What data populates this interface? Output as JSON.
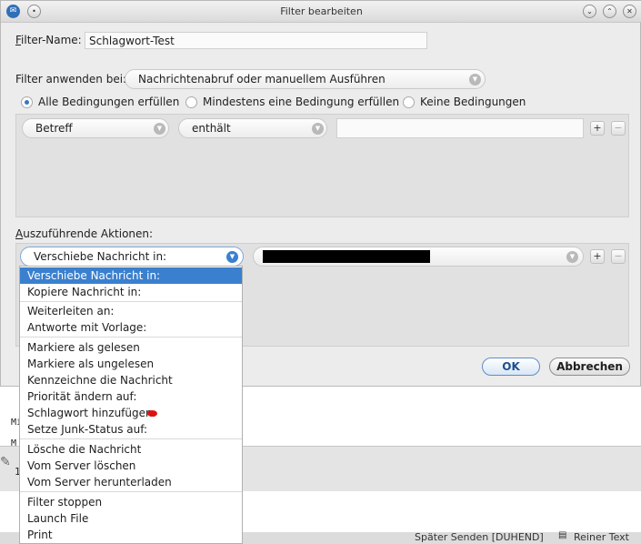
{
  "window": {
    "title": "Filter bearbeiten"
  },
  "filter_name": {
    "label": "Filter-Name:",
    "value": "Schlagwort-Test"
  },
  "apply": {
    "label": "Filter anwenden bei:",
    "value": "Nachrichtenabruf oder manuellem Ausführen"
  },
  "conditions": {
    "all": "Alle Bedingungen erfüllen",
    "any": "Mindestens eine Bedingung erfüllen",
    "none": "Keine Bedingungen",
    "selected": "all"
  },
  "rule": {
    "field": "Betreff",
    "operator": "enthält",
    "value": ""
  },
  "actions": {
    "label": "Auszuführende Aktionen:",
    "action": "Verschiebe Nachricht in:",
    "target": ""
  },
  "buttons": {
    "plus": "+",
    "minus": "−",
    "ok": "OK",
    "cancel": "Abbrechen"
  },
  "menu": {
    "items": [
      "Verschiebe Nachricht in:",
      "Kopiere Nachricht in:",
      "Weiterleiten an:",
      "Antworte mit Vorlage:",
      "Markiere als gelesen",
      "Markiere als ungelesen",
      "Kennzeichne die Nachricht",
      "Priorität ändern auf:",
      "Schlagwort hinzufügen:",
      "Setze Junk-Status auf:",
      "Lösche die Nachricht",
      "Vom Server löschen",
      "Vom Server herunterladen",
      "Filter stoppen",
      "Launch File",
      "Print"
    ],
    "selected_index": 0,
    "tag_color": "#e01010"
  },
  "background": {
    "text1": "Mi",
    "text2": "M",
    "text3": "1",
    "status_left": "Später Senden [DUHEND]",
    "status_right": "Reiner Text"
  },
  "colors": {
    "accent": "#3a80cf",
    "redacted": "#000000"
  }
}
